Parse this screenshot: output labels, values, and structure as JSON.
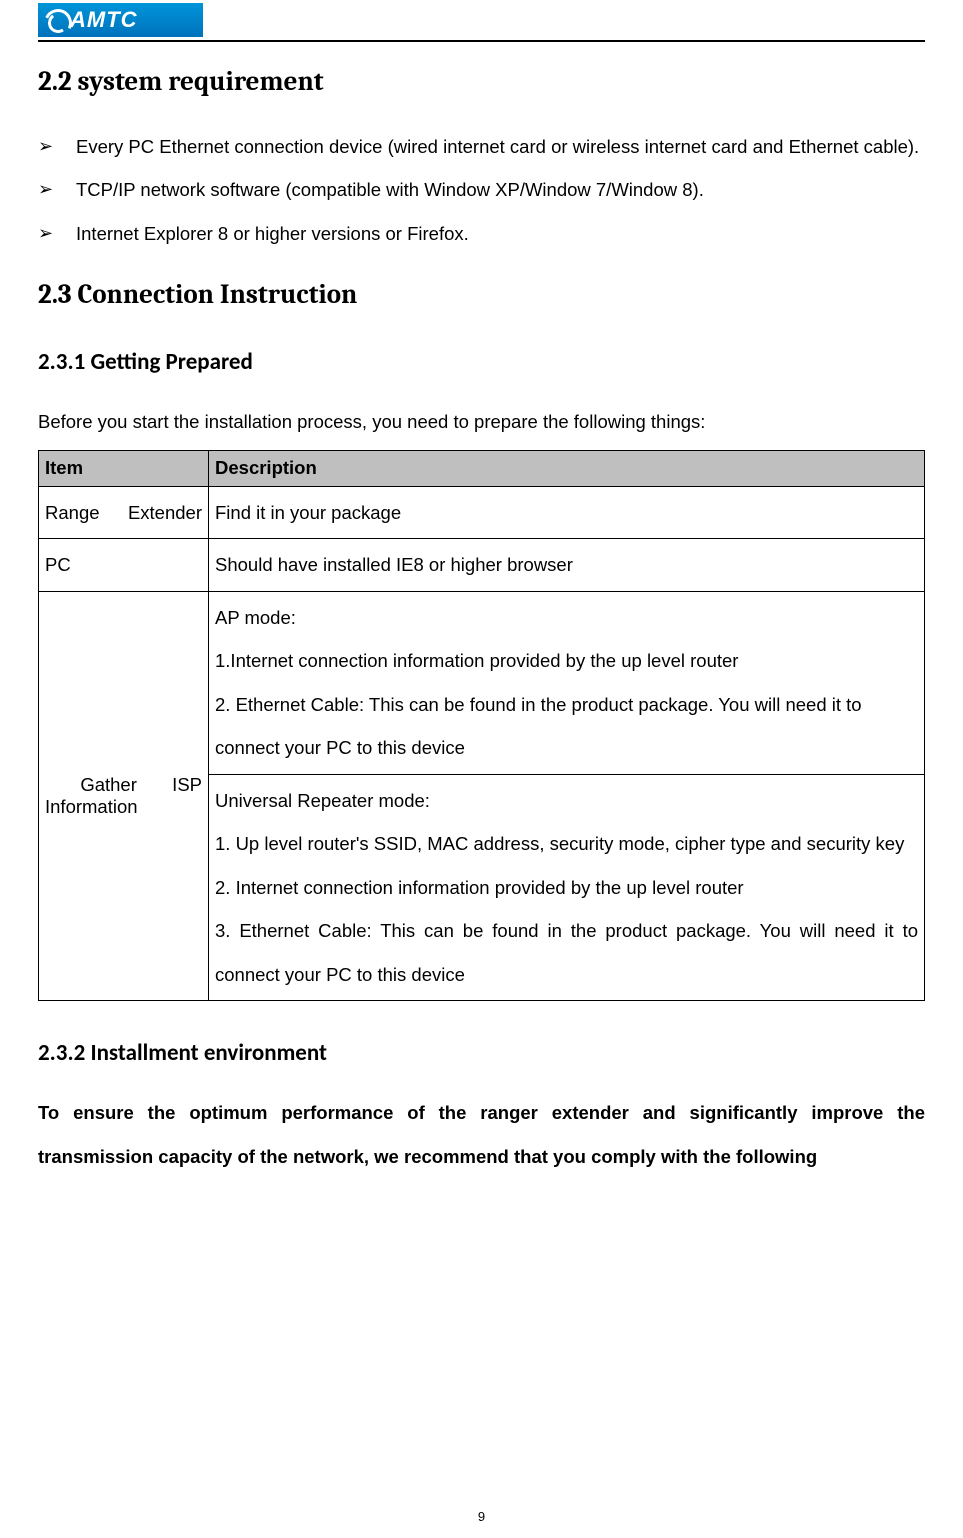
{
  "logo": {
    "text": "AMTC"
  },
  "sections": {
    "s22": {
      "title": "2.2 system requirement",
      "bullets": [
        "Every PC Ethernet connection device (wired internet card or wireless internet card and Ethernet cable).",
        "TCP/IP network software (compatible with Window XP/Window 7/Window 8).",
        "Internet Explorer 8 or higher versions or Firefox."
      ]
    },
    "s23": {
      "title": "2.3 Connection Instruction",
      "s231": {
        "title": "2.3.1 Getting Prepared",
        "intro": "Before you start the installation process, you need to prepare the following things:",
        "table": {
          "head": {
            "item": "Item",
            "desc": "Description"
          },
          "rows": {
            "range": {
              "item": "Range Extender",
              "desc": "Find it in your package"
            },
            "pc": {
              "item": "PC",
              "desc": "Should have installed IE8 or higher browser"
            },
            "isp": {
              "item": " Gather ISP Information",
              "ap": "AP mode:\n1.Internet connection information provided by the up level router\n2. Ethernet Cable: This can be found in the product package. You will need it to connect your PC to this device",
              "ur": "Universal Repeater mode:\n1. Up level router's SSID, MAC address, security mode, cipher type and security key\n2. Internet connection information provided by the up level router\n3. Ethernet Cable: This can be found in the product package. You will need it to connect your PC to this device"
            }
          }
        }
      },
      "s232": {
        "title": "2.3.2 Installment environment",
        "para": "To ensure the optimum performance of the ranger extender and significantly improve the transmission capacity of the network, we recommend that you comply with the following"
      }
    }
  },
  "page_number": "9"
}
